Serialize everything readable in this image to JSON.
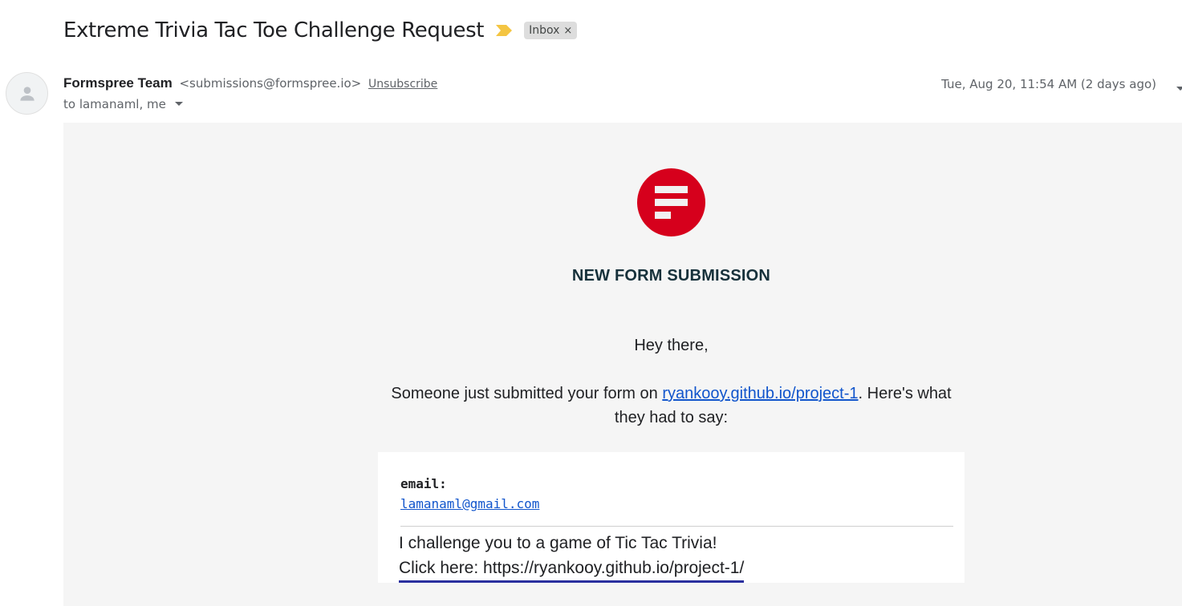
{
  "subject": {
    "title": "Extreme Trivia Tac Toe Challenge Request",
    "importance_icon": "importance-marker-icon",
    "label": "Inbox",
    "label_remove": "×"
  },
  "header": {
    "sender_name": "Formspree Team",
    "sender_email": "<submissions@formspree.io>",
    "unsubscribe": "Unsubscribe",
    "recipients": "to lamanaml, me",
    "date": "Tue, Aug 20, 11:54 AM (2 days ago)"
  },
  "body": {
    "heading": "NEW FORM SUBMISSION",
    "greeting": "Hey there,",
    "intro_before": "Someone just submitted your form on ",
    "intro_link": "ryankooy.github.io/project-1",
    "intro_after": ". Here's what they had to say:",
    "field_label": "email:",
    "field_value": "lamanaml@gmail.com",
    "message_line1": "I challenge you to a game of Tic Tac Trivia!",
    "message_line2": "Click here: https://ryankooy.github.io/project-1/"
  },
  "colors": {
    "logo": "#d6001c",
    "link": "#1155cc",
    "importance": "#f4c542",
    "underline": "#2a2f9e"
  }
}
